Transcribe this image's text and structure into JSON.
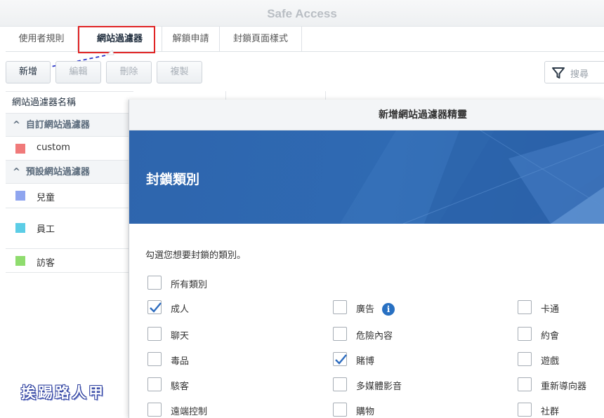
{
  "window": {
    "title": "Safe Access"
  },
  "tabs": [
    {
      "label": "使用者規則"
    },
    {
      "label": "網站過濾器"
    },
    {
      "label": "解鎖申請"
    },
    {
      "label": "封鎖頁面樣式"
    }
  ],
  "toolbar": {
    "add_label": "新增",
    "edit_label": "編輯",
    "delete_label": "刪除",
    "copy_label": "複製",
    "search_placeholder": "搜尋",
    "search_icon": "funnel-icon"
  },
  "filter_list": {
    "header": "網站過濾器名稱",
    "groups": [
      {
        "label": "自訂網站過濾器",
        "items": [
          {
            "name": "custom",
            "color": "#f07a7a"
          }
        ]
      },
      {
        "label": "預設網站過濾器",
        "items": [
          {
            "name": "兒童",
            "color": "#8fa5ef"
          },
          {
            "name": "員工",
            "color": "#5ccde6"
          },
          {
            "name": "訪客",
            "color": "#8fdc6e"
          }
        ]
      }
    ]
  },
  "wizard": {
    "title": "新增網站過濾器精靈",
    "heading": "封鎖類別",
    "instruction": "勾選您想要封鎖的類別。",
    "all_label": "所有類別",
    "columns": [
      [
        {
          "label": "成人",
          "checked": true
        },
        {
          "label": "聊天",
          "checked": false
        },
        {
          "label": "毒品",
          "checked": false
        },
        {
          "label": "駭客",
          "checked": false
        },
        {
          "label": "遠端控制",
          "checked": false
        }
      ],
      [
        {
          "label": "廣告",
          "checked": false,
          "info": true
        },
        {
          "label": "危險內容",
          "checked": false
        },
        {
          "label": "賭博",
          "checked": true
        },
        {
          "label": "多媒體影音",
          "checked": false
        },
        {
          "label": "購物",
          "checked": false
        }
      ],
      [
        {
          "label": "卡通",
          "checked": false
        },
        {
          "label": "約會",
          "checked": false
        },
        {
          "label": "遊戲",
          "checked": false
        },
        {
          "label": "重新導向器",
          "checked": false
        },
        {
          "label": "社群",
          "checked": false
        }
      ]
    ]
  },
  "colors": {
    "accent": "#2e65ad",
    "highlight": "#e02424",
    "check": "#2d6cbf"
  },
  "watermark": "挨踢路人甲"
}
